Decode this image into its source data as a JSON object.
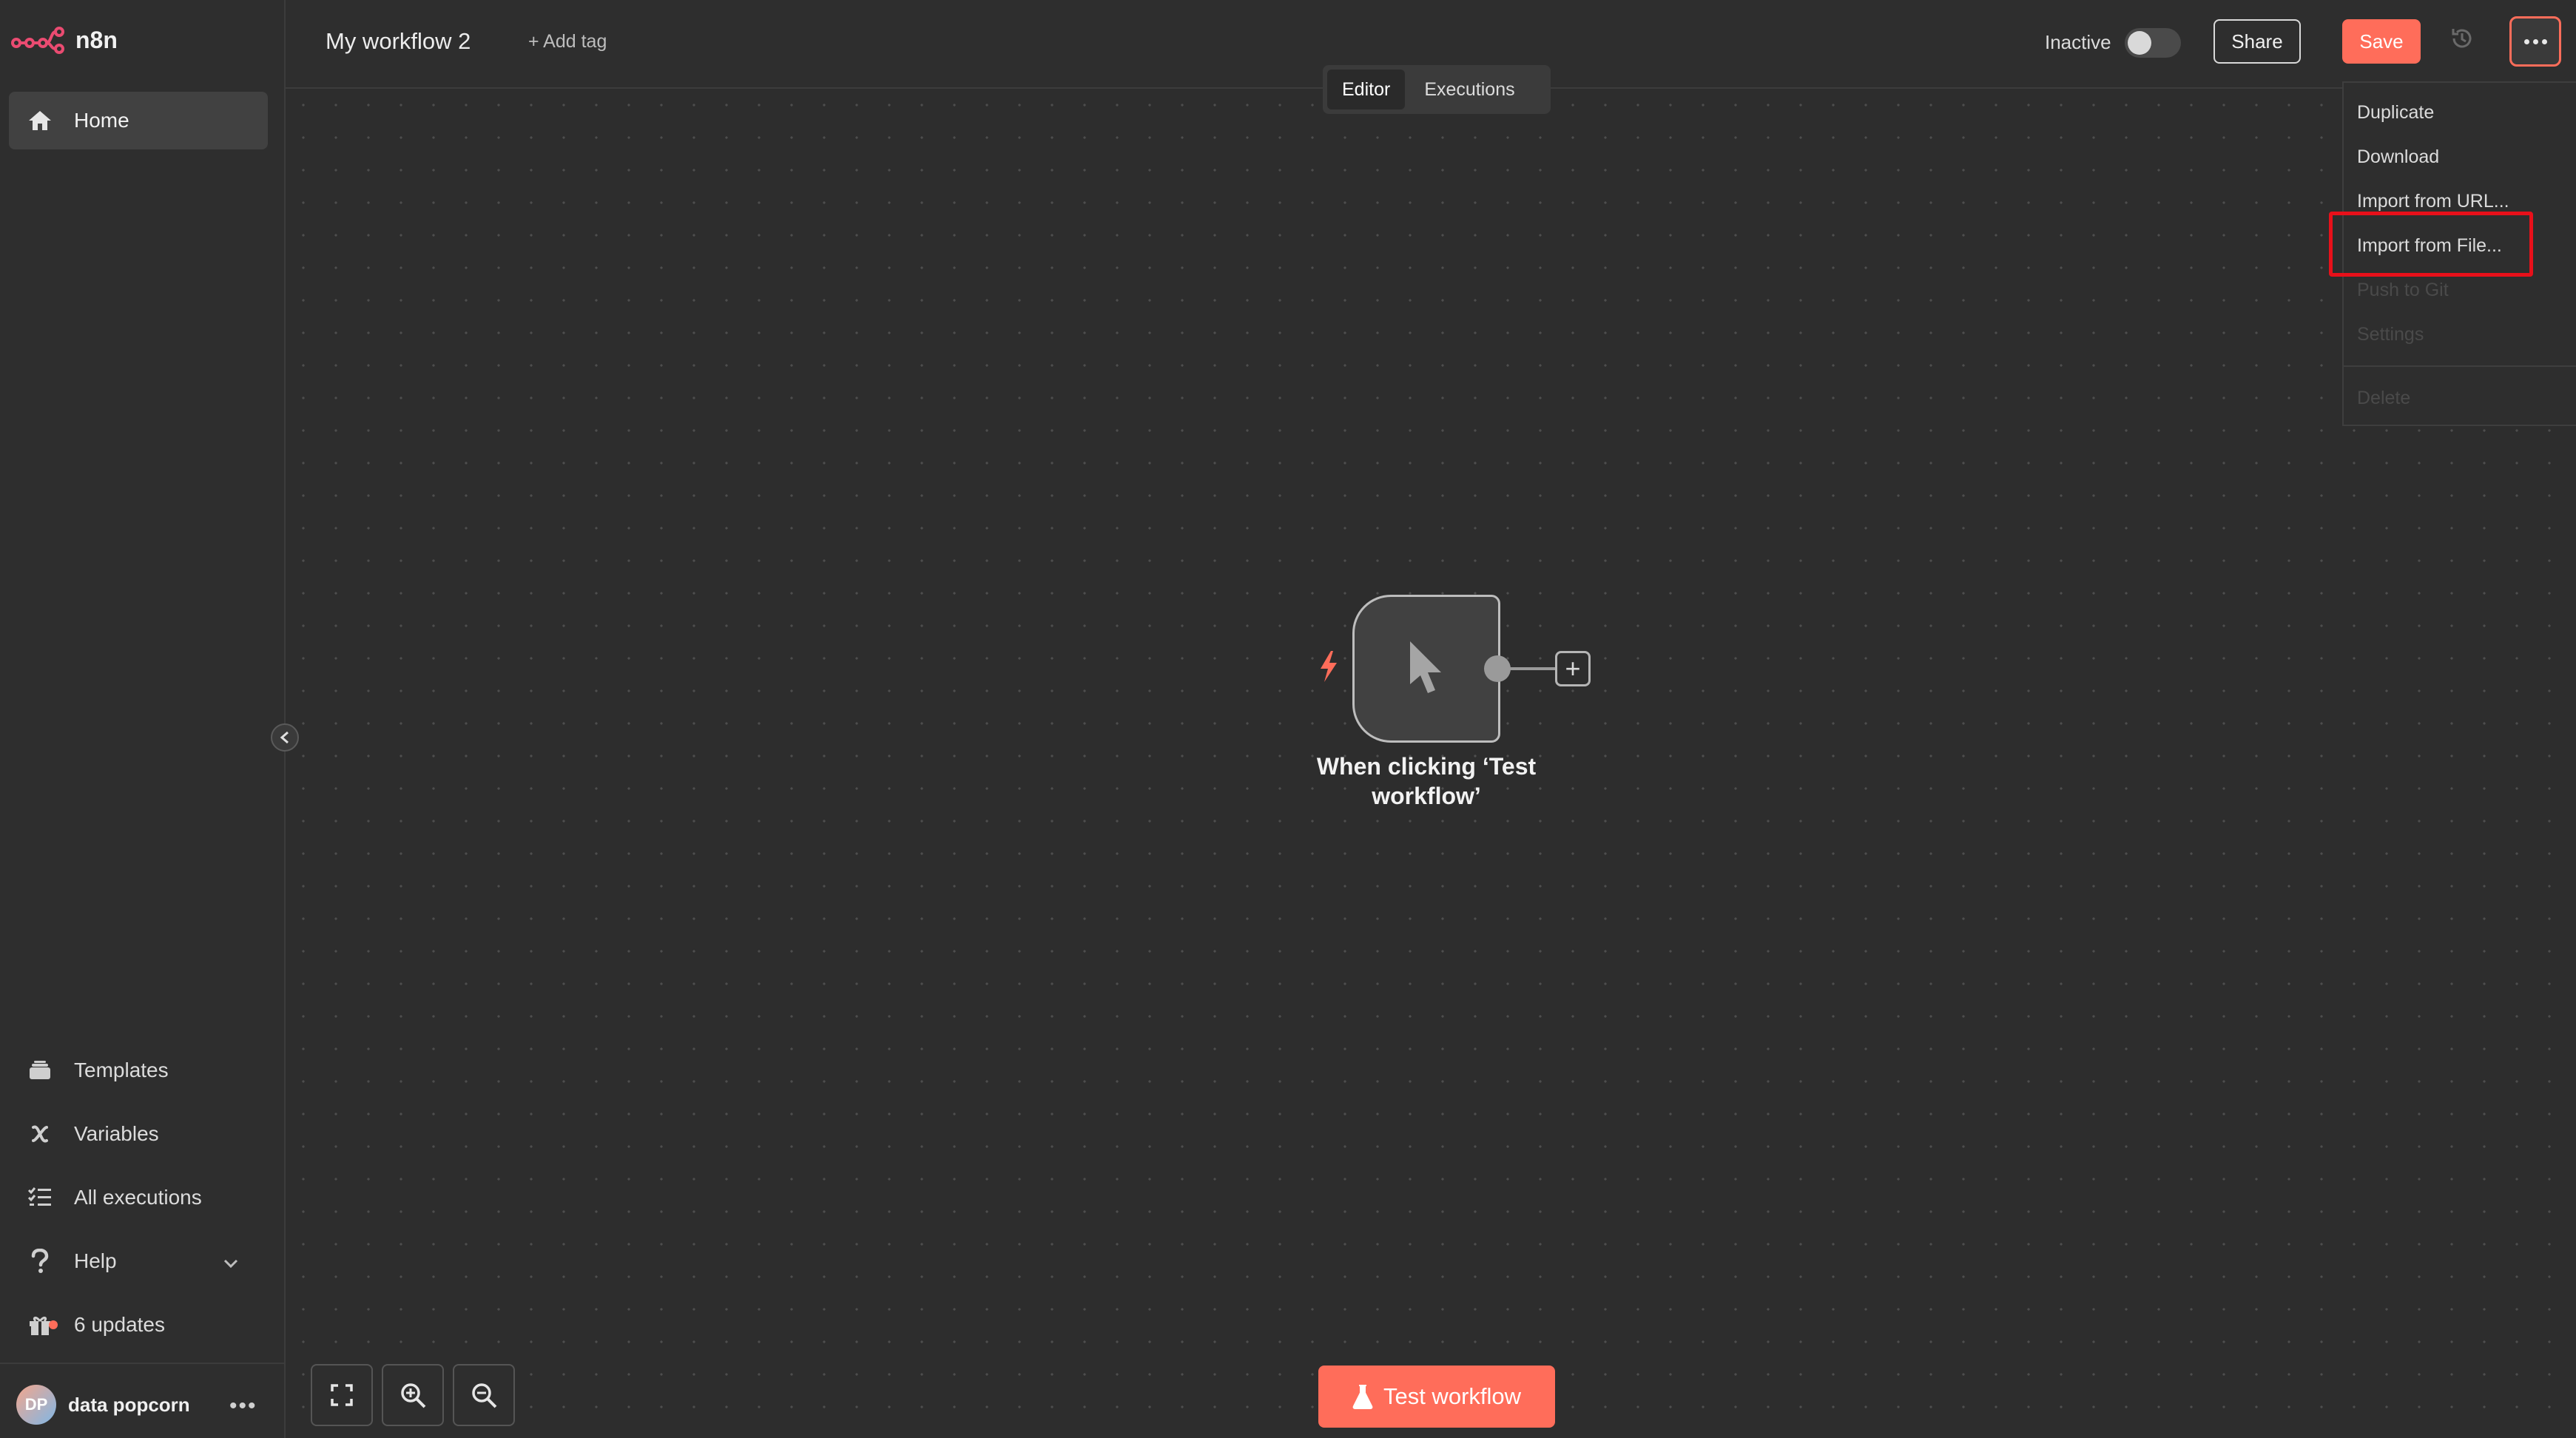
{
  "app": {
    "logo_text": "n8n"
  },
  "sidebar": {
    "home": "Home",
    "bottom_items": [
      {
        "label": "Templates"
      },
      {
        "label": "Variables"
      },
      {
        "label": "All executions"
      },
      {
        "label": "Help"
      },
      {
        "label": "6 updates"
      }
    ],
    "user": {
      "initials": "DP",
      "name": "data popcorn"
    }
  },
  "header": {
    "workflow_name": "My workflow 2",
    "add_tag": "+ Add tag",
    "status_label": "Inactive",
    "active": false,
    "share_label": "Share",
    "save_label": "Save"
  },
  "tabs": [
    {
      "label": "Editor",
      "active": true
    },
    {
      "label": "Executions",
      "active": false
    }
  ],
  "node": {
    "label_line1": "When clicking ‘Test",
    "label_line2": "workflow’"
  },
  "test_button": "Test workflow",
  "menu": {
    "items": [
      {
        "label": "Duplicate",
        "enabled": true
      },
      {
        "label": "Download",
        "enabled": true
      },
      {
        "label": "Import from URL...",
        "enabled": true
      },
      {
        "label": "Import from File...",
        "enabled": true,
        "highlighted": true
      },
      {
        "label": "Push to Git",
        "enabled": false
      },
      {
        "label": "Settings",
        "enabled": false
      },
      {
        "label": "Delete",
        "enabled": false
      }
    ]
  },
  "colors": {
    "accent": "#ff6d5a",
    "highlight": "#e8101a",
    "background": "#2d2d2d"
  }
}
